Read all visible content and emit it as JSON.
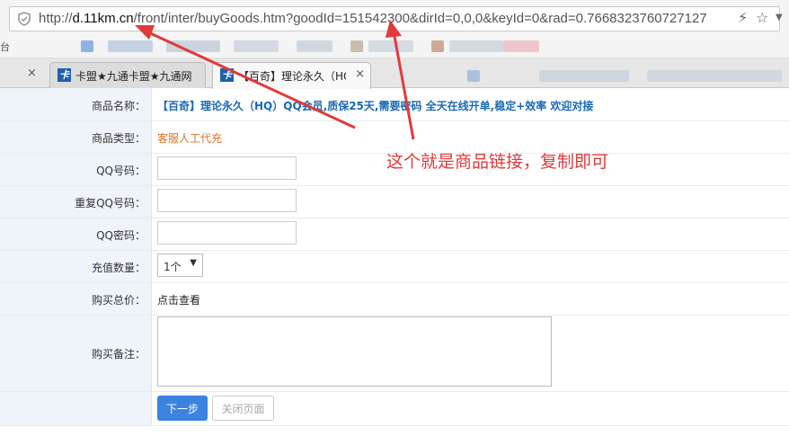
{
  "browser": {
    "url_prefix": "http://",
    "url_domain": "d.11km.cn",
    "url_rest": "/front/inter/buyGoods.htm?goodId=151542300&dirId=0,0,0&keyId=0&rad=0.7668323760727127",
    "bookmark_partial": "台",
    "tabs": [
      {
        "title": "卡盟★九通卡盟★九通网",
        "close": "×"
      },
      {
        "title": "【百奇】理论永久（HQ",
        "close": "×"
      }
    ],
    "first_tab_close": "×",
    "favicon_letter": "卡"
  },
  "form": {
    "rows": [
      {
        "label": "商品名称：",
        "value": "【百奇】理论永久（HQ）QQ会员,质保25天,需要密码 全天在线开单,稳定+效率 欢迎对接"
      },
      {
        "label": "商品类型：",
        "value": "客服人工代充"
      },
      {
        "label": "QQ号码：",
        "value": ""
      },
      {
        "label": "重复QQ号码：",
        "value": ""
      },
      {
        "label": "QQ密码：",
        "value": ""
      },
      {
        "label": "充值数量：",
        "value": "1个"
      },
      {
        "label": "购买总价：",
        "value": "点击查看"
      },
      {
        "label": "购买备注：",
        "value": ""
      }
    ],
    "next_button": "下一步",
    "close_button": "关闭页面"
  },
  "annotation": "这个就是商品链接，复制即可",
  "colors": {
    "accent": "#3b83e0",
    "annotation": "#e23a3a",
    "product_name": "#1a6ab4",
    "product_type": "#e0702a"
  }
}
